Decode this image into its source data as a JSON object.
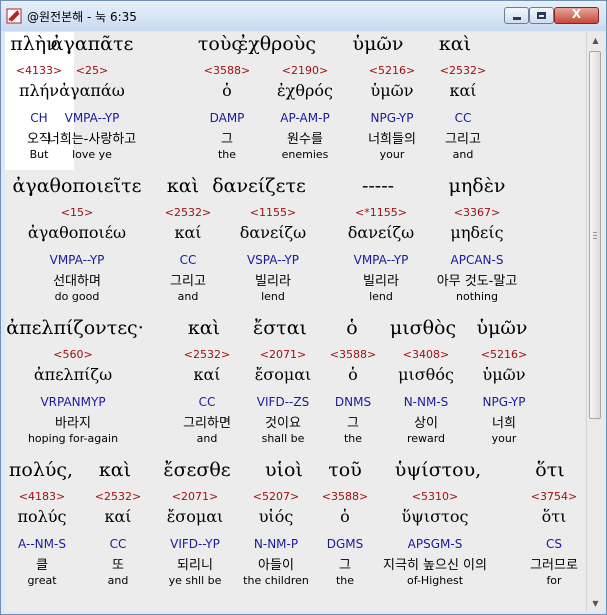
{
  "window": {
    "title": "@원전본해 - 눅 6:35",
    "close_glyph": "X"
  },
  "rows": [
    {
      "heading": [
        "πλὴν",
        "ἀγαπᾶτε",
        "τοὺς",
        "ἐχθροὺς",
        "ὑμῶν",
        "καὶ"
      ],
      "numbers": [
        "<4133>",
        "<25>",
        "<3588>",
        "<2190>",
        "<5216>",
        "<2532>"
      ],
      "lemmas": [
        "πλήν",
        "ἀγαπάω",
        "ὁ",
        "ἐχθρός",
        "ὑμῶν",
        "καί"
      ],
      "parsing": [
        "CH",
        "VMPA--YP",
        "DAMP",
        "AP-AM-P",
        "NPG-YP",
        "CC"
      ],
      "korean": [
        "오직",
        "너희는-사랑하고",
        "그",
        "원수를",
        "너희들의",
        "그리고"
      ],
      "english": [
        "But",
        "love ye",
        "the",
        "enemies",
        "your",
        "and"
      ]
    },
    {
      "heading": [
        "ἀγαθοποιεῖτε",
        "καὶ",
        "δανείζετε",
        "-----",
        "μηδὲν"
      ],
      "numbers": [
        "<15>",
        "<2532>",
        "<1155>",
        "<*1155>",
        "<3367>"
      ],
      "lemmas": [
        "ἀγαθοποιέω",
        "καί",
        "δανείζω",
        "δανείζω",
        "μηδείς"
      ],
      "parsing": [
        "VMPA--YP",
        "CC",
        "VSPA--YP",
        "VMPA--YP",
        "APCAN-S"
      ],
      "korean": [
        "선대하며",
        "그리고",
        "빌리라",
        "빌리라",
        "아무 것도-말고"
      ],
      "english": [
        "do good",
        "and",
        "lend",
        "lend",
        "nothing"
      ]
    },
    {
      "heading": [
        "ἀπελπίζοντες·",
        "καὶ",
        "ἔσται",
        "ὁ",
        "μισθὸς",
        "ὑμῶν"
      ],
      "numbers": [
        "<560>",
        "<2532>",
        "<2071>",
        "<3588>",
        "<3408>",
        "<5216>"
      ],
      "lemmas": [
        "ἀπελπίζω",
        "καί",
        "ἔσομαι",
        "ὁ",
        "μισθός",
        "ὑμῶν"
      ],
      "parsing": [
        "VRPANMYP",
        "CC",
        "VIFD--ZS",
        "DNMS",
        "N-NM-S",
        "NPG-YP"
      ],
      "korean": [
        "바라지",
        "그리하면",
        "것이요",
        "그",
        "상이",
        "너희"
      ],
      "english": [
        "hoping for-again",
        "and",
        "shall be",
        "the",
        "reward",
        "your"
      ]
    },
    {
      "heading": [
        "πολύς,",
        "καὶ",
        "ἔσεσθε",
        "υἱοὶ",
        "τοῦ",
        "ὑψίστου,",
        "ὅτι"
      ],
      "numbers": [
        "<4183>",
        "<2532>",
        "<2071>",
        "<5207>",
        "<3588>",
        "<5310>",
        "<3754>"
      ],
      "lemmas": [
        "πολύς",
        "καί",
        "ἔσομαι",
        "υἱός",
        "ὁ",
        "ὕψιστος",
        "ὅτι"
      ],
      "parsing": [
        "A--NM-S",
        "CC",
        "VIFD--YP",
        "N-NM-P",
        "DGMS",
        "APSGM-S",
        "CS"
      ],
      "korean": [
        "클",
        "또",
        "되리니",
        "아들이",
        "그",
        "지극히 높으신 이의",
        "그러므로"
      ],
      "english": [
        "great",
        "and",
        "ye shll be",
        "the children",
        "the",
        "of-Highest",
        "for"
      ]
    }
  ]
}
